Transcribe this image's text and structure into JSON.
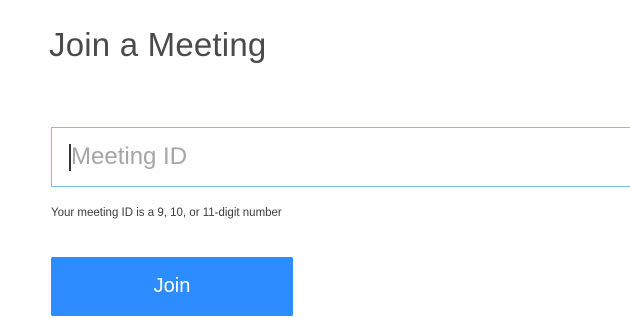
{
  "page": {
    "title": "Join a Meeting"
  },
  "meeting_id": {
    "value": "",
    "placeholder": "Meeting ID",
    "helper_text": "Your meeting ID is a 9, 10, or 11-digit number"
  },
  "actions": {
    "join_label": "Join"
  },
  "colors": {
    "accent": "#2d8cff",
    "input_border": "#6ec6e6"
  }
}
